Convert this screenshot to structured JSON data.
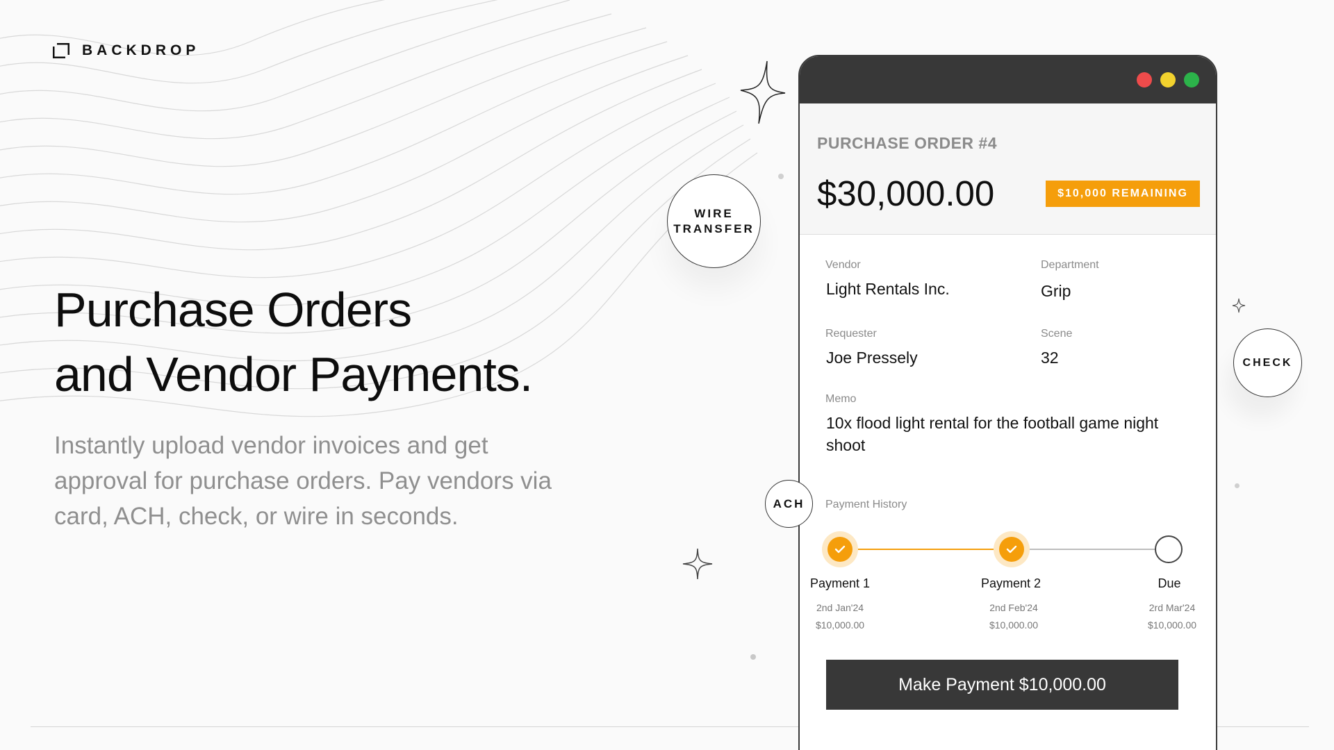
{
  "brand": {
    "name": "BACKDROP",
    "icon": "backdrop-logo-icon"
  },
  "hero": {
    "title_line1": "Purchase Orders",
    "title_line2": "and Vendor Payments.",
    "description": "Instantly upload vendor invoices and get approval for purchase orders. Pay vendors via card, ACH, check, or wire in seconds."
  },
  "window": {
    "controls": {
      "close_color": "#ee4b4b",
      "minimize_color": "#f2d22e",
      "maximize_color": "#2cb34a"
    },
    "po_title": "PURCHASE ORDER #4",
    "po_amount": "$30,000.00",
    "remaining_badge": "$10,000 REMAINING",
    "fields": {
      "vendor_label": "Vendor",
      "vendor_value": "Light Rentals Inc.",
      "department_label": "Department",
      "department_value": "Grip",
      "requester_label": "Requester",
      "requester_value": "Joe Pressely",
      "scene_label": "Scene",
      "scene_value": "32",
      "memo_label": "Memo",
      "memo_value": "10x flood light rental for the football game night shoot"
    },
    "payment_history": {
      "label": "Payment History",
      "steps": [
        {
          "name": "Payment 1",
          "date": "2nd Jan'24",
          "amount": "$10,000.00",
          "status": "paid"
        },
        {
          "name": "Payment 2",
          "date": "2nd Feb'24",
          "amount": "$10,000.00",
          "status": "paid"
        },
        {
          "name": "Due",
          "date": "2rd Mar'24",
          "amount": "$10,000.00",
          "status": "due"
        }
      ]
    },
    "action_button": "Make Payment $10,000.00"
  },
  "payment_methods": {
    "wire_line1": "WIRE",
    "wire_line2": "TRANSFER",
    "check": "CHECK",
    "ach": "ACH"
  },
  "colors": {
    "accent": "#f59e0b",
    "dark": "#383838",
    "muted": "#8f8f8f"
  }
}
